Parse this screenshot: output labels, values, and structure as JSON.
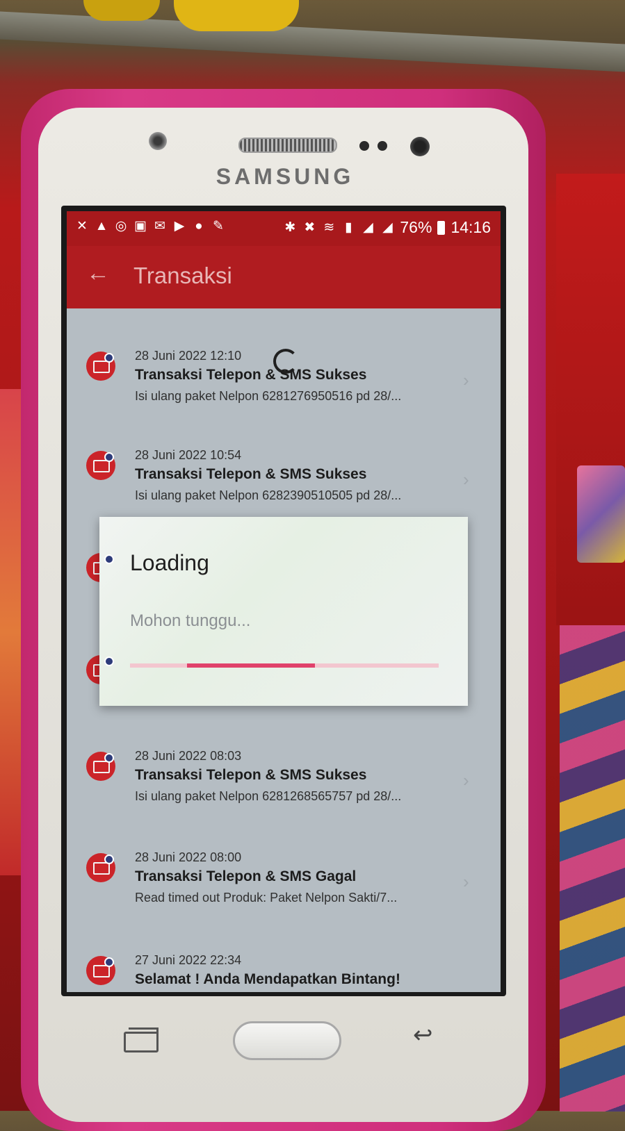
{
  "device": {
    "brand": "SAMSUNG"
  },
  "status_bar": {
    "icons_left": [
      "missed-call-icon",
      "warning-icon",
      "sync-icon",
      "flipboard-icon",
      "mail-icon",
      "youtube-icon",
      "chat-icon",
      "wrench-icon"
    ],
    "icons_right": [
      "bluetooth-icon",
      "mute-icon",
      "wifi-icon",
      "sim-1-icon",
      "signal-icon",
      "signal-icon"
    ],
    "battery": "76%",
    "time": "14:16"
  },
  "app_bar": {
    "title": "Transaksi"
  },
  "transactions": [
    {
      "date": "28 Juni 2022 12:10",
      "title": "Transaksi Telepon & SMS Sukses",
      "desc": "Isi ulang paket Nelpon 6281276950516 pd 28/..."
    },
    {
      "date": "28 Juni 2022 10:54",
      "title": "Transaksi Telepon & SMS Sukses",
      "desc": "Isi ulang paket Nelpon 6282390510505 pd 28/..."
    },
    {
      "date": "28 Juni 2022 08:03",
      "title": "Transaksi Telepon & SMS Sukses",
      "desc": "Isi ulang paket Nelpon 6281268565757 pd 28/..."
    },
    {
      "date": "28 Juni 2022 08:00",
      "title": "Transaksi Telepon & SMS Gagal",
      "desc": "Read timed out Produk: Paket Nelpon Sakti/7..."
    },
    {
      "date": "27 Juni 2022 22:34",
      "title": "Selamat ! Anda Mendapatkan Bintang!",
      "desc": ""
    }
  ],
  "dialog": {
    "title": "Loading",
    "message": "Mohon tunggu...",
    "progress_start": 0.185,
    "progress_end": 0.6
  },
  "colors": {
    "app_red": "#b01c20",
    "status_red": "#a8191c",
    "icon_red": "#d6262c",
    "progress_pink": "#e0426b",
    "case_pink": "#d83a86"
  }
}
